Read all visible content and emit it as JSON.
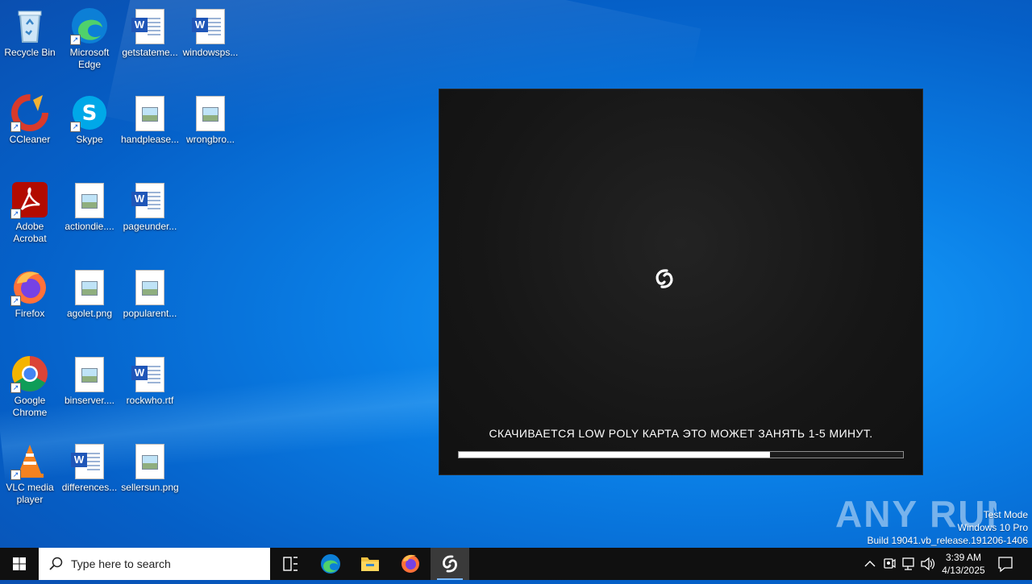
{
  "desktop_icons": [
    {
      "label": "Recycle Bin",
      "icon": "recycle-bin-icon"
    },
    {
      "label": "Microsoft Edge",
      "icon": "edge-icon"
    },
    {
      "label": "getstateme...",
      "icon": "word-document-icon"
    },
    {
      "label": "windowsps...",
      "icon": "word-document-icon"
    },
    {
      "label": "CCleaner",
      "icon": "ccleaner-icon"
    },
    {
      "label": "Skype",
      "icon": "skype-icon"
    },
    {
      "label": "handplease...",
      "icon": "image-file-icon"
    },
    {
      "label": "wrongbro...",
      "icon": "image-file-icon"
    },
    {
      "label": "Adobe Acrobat",
      "icon": "acrobat-icon"
    },
    {
      "label": "actiondie....",
      "icon": "image-file-icon"
    },
    {
      "label": "pageunder...",
      "icon": "word-document-icon"
    },
    {
      "label": "Firefox",
      "icon": "firefox-icon"
    },
    {
      "label": "agolet.png",
      "icon": "image-file-icon"
    },
    {
      "label": "popularent...",
      "icon": "image-file-icon"
    },
    {
      "label": "Google Chrome",
      "icon": "chrome-icon"
    },
    {
      "label": "binserver....",
      "icon": "image-file-icon"
    },
    {
      "label": "rockwho.rtf",
      "icon": "word-document-icon"
    },
    {
      "label": "VLC media player",
      "icon": "vlc-icon"
    },
    {
      "label": "differences...",
      "icon": "word-document-icon"
    },
    {
      "label": "sellersun.png",
      "icon": "image-file-icon"
    }
  ],
  "loader": {
    "message": "СКАЧИВАЕТСЯ LOW POLY КАРТА ЭТО МОЖЕТ ЗАНЯТЬ 1-5 МИНУТ.",
    "progress_percent": 70
  },
  "watermark": {
    "text": "ANY RUN"
  },
  "os_info": {
    "line1": "Test Mode",
    "line2": "Windows 10 Pro",
    "line3": "Build 19041.vb_release.191206-1406"
  },
  "taskbar": {
    "search_placeholder": "Type here to search",
    "apps": [
      "task-view-icon",
      "edge-icon",
      "file-explorer-icon",
      "firefox-icon",
      "loader-app-icon"
    ],
    "clock_time": "3:39 AM",
    "clock_date": "4/13/2025"
  },
  "colors": {
    "accent": "#7ab8ff",
    "desktop_blue": "#0a7fe6",
    "loader_bg": "#161616"
  }
}
